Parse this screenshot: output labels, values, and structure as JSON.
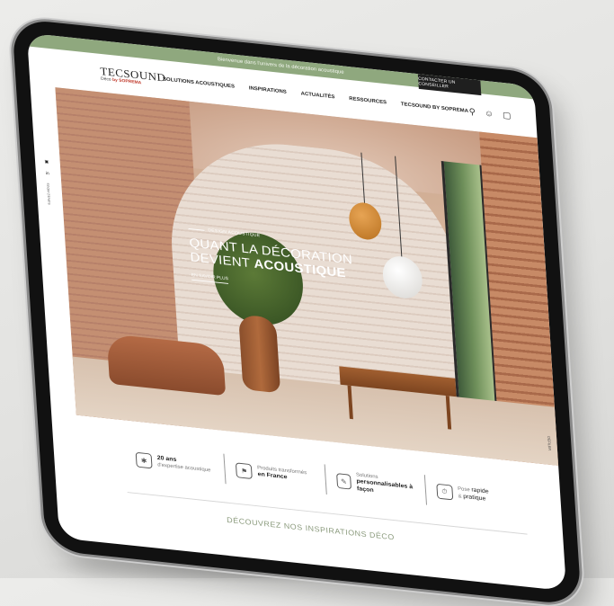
{
  "promo": {
    "text": "Bienvenue dans l'univers de la décoration acoustique",
    "contact_button": "CONTACTER UN CONSEILLER"
  },
  "logo": {
    "brand": "TECSOUND",
    "tagline_script": "Déco",
    "tagline_by": "by SOPREMA"
  },
  "nav": {
    "items": [
      "SOLUTIONS ACOUSTIQUES",
      "INSPIRATIONS",
      "ACTUALITÉS",
      "RESSOURCES",
      "TECSOUND BY SOPREMA"
    ],
    "icons": [
      "search-icon",
      "user-icon",
      "bag-icon"
    ]
  },
  "hero": {
    "tag": "DESIGN ACOUSTIQUE",
    "line1": "QUANT LA DÉCORATION",
    "line2_prefix": "DEVIENT",
    "line2_bold": "ACOUSTIQUE",
    "cta": "EN SAVOIR PLUS"
  },
  "social": {
    "icons": [
      "instagram-icon",
      "linkedin-icon"
    ],
    "label": "SUIVEZ-NOUS"
  },
  "side_right_label": "DÉFILER",
  "features": [
    {
      "icon": "puzzle-icon",
      "strong": "20 ans",
      "text": "d'expertise acoustique"
    },
    {
      "icon": "france-flag-icon",
      "text": "Produits transformés",
      "strong": "en France"
    },
    {
      "icon": "design-icon",
      "text": "Solutions",
      "strong": "personnalisables à façon"
    },
    {
      "icon": "timer-icon",
      "text_prefix": "Pose",
      "strong_rapide": "rapide",
      "text_mid": "&",
      "strong_pratique": "pratique"
    }
  ],
  "discover_heading": "DÉCOUVREZ NOS INSPIRATIONS DÉCO"
}
